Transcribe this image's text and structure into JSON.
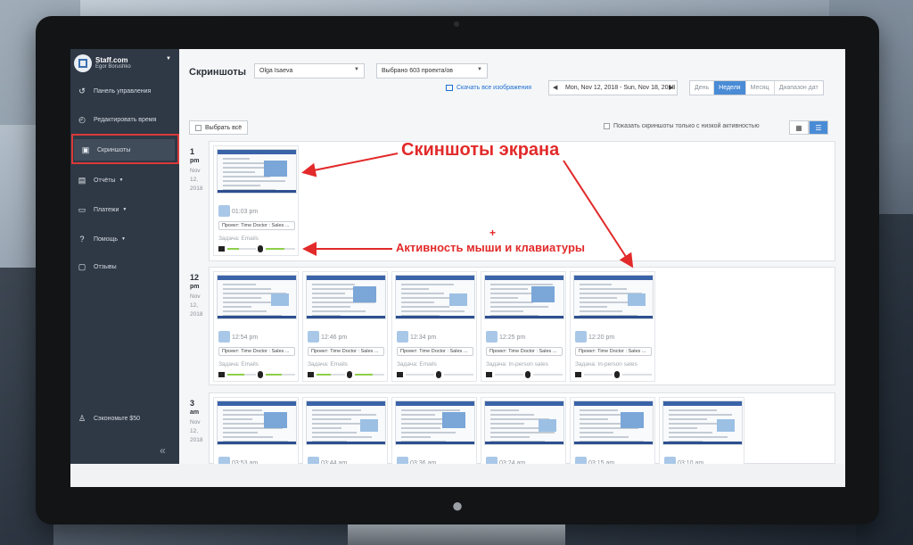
{
  "sidebar": {
    "brand": "Staff.com",
    "user": "Egor Borushko",
    "items": [
      {
        "label": "Панель управления",
        "icon": "history-icon"
      },
      {
        "label": "Редактировать время",
        "icon": "clock-edit-icon"
      },
      {
        "label": "Скриншоты",
        "icon": "image-icon"
      },
      {
        "label": "Отчёты",
        "icon": "report-icon"
      },
      {
        "label": "Платежи",
        "icon": "card-icon"
      },
      {
        "label": "Помощь",
        "icon": "help-icon"
      },
      {
        "label": "Отзывы",
        "icon": "feedback-icon"
      }
    ],
    "save": "Сэкономьте $50",
    "collapse": "«"
  },
  "header": {
    "title": "Скриншоты",
    "user_select": "Olga Isaeva",
    "project_select": "Выбрано 603 проекта/ов",
    "download": "Скачать все изображения",
    "date_range": "Mon, Nov 12, 2018 - Sun, Nov 18, 2018",
    "prev": "◀",
    "next": "▶",
    "periods": [
      "День",
      "Неделя",
      "Месяц",
      "Диапазон дат"
    ],
    "active_period": "Неделя"
  },
  "toolbar": {
    "select_all": "Выбрать всё",
    "low_activity": "Показать скриншоты только с низкой активностью",
    "view_grid": "▦",
    "view_list": "☰"
  },
  "groups": [
    {
      "hour": "1",
      "ampm": "pm",
      "date_lines": [
        "Nov",
        "12,",
        "2018"
      ],
      "cards": [
        {
          "time": "01:03 pm",
          "project": "Проект: Time Doctor : Sales ...",
          "task": "Задача: Emails",
          "mouse": 0.4,
          "keys": 0.65
        }
      ]
    },
    {
      "hour": "12",
      "ampm": "pm",
      "date_lines": [
        "Nov",
        "12,",
        "2018"
      ],
      "cards": [
        {
          "time": "12:54 pm",
          "project": "Проект: Time Doctor : Sales ...",
          "task": "Задача: Emails",
          "mouse": 0.6,
          "keys": 0.55
        },
        {
          "time": "12:46 pm",
          "project": "Проект: Time Doctor : Sales ...",
          "task": "Задача: Emails",
          "mouse": 0.5,
          "keys": 0.6
        },
        {
          "time": "12:34 pm",
          "project": "Проект: Time Doctor : Sales ...",
          "task": "Задача: Emails",
          "mouse": 0.0,
          "keys": 0.0
        },
        {
          "time": "12:25 pm",
          "project": "Проект: Time Doctor : Sales ...",
          "task": "Задача: In-person sales",
          "mouse": 0.0,
          "keys": 0.0
        },
        {
          "time": "12:20 pm",
          "project": "Проект: Time Doctor : Sales ...",
          "task": "Задача: In-person sales",
          "mouse": 0.0,
          "keys": 0.0
        }
      ]
    },
    {
      "hour": "3",
      "ampm": "am",
      "date_lines": [
        "Nov",
        "12,",
        "2018"
      ],
      "cards": [
        {
          "time": "03:53 am"
        },
        {
          "time": "03:44 am"
        },
        {
          "time": "03:36 am"
        },
        {
          "time": "03:24 am"
        },
        {
          "time": "03:15 am"
        },
        {
          "time": "03:10 am"
        }
      ]
    }
  ],
  "annotations": {
    "screens": "Скиншоты экрана",
    "plus": "+",
    "activity": "Активность мыши и клавиатуры",
    "color": "#e22a2a"
  }
}
